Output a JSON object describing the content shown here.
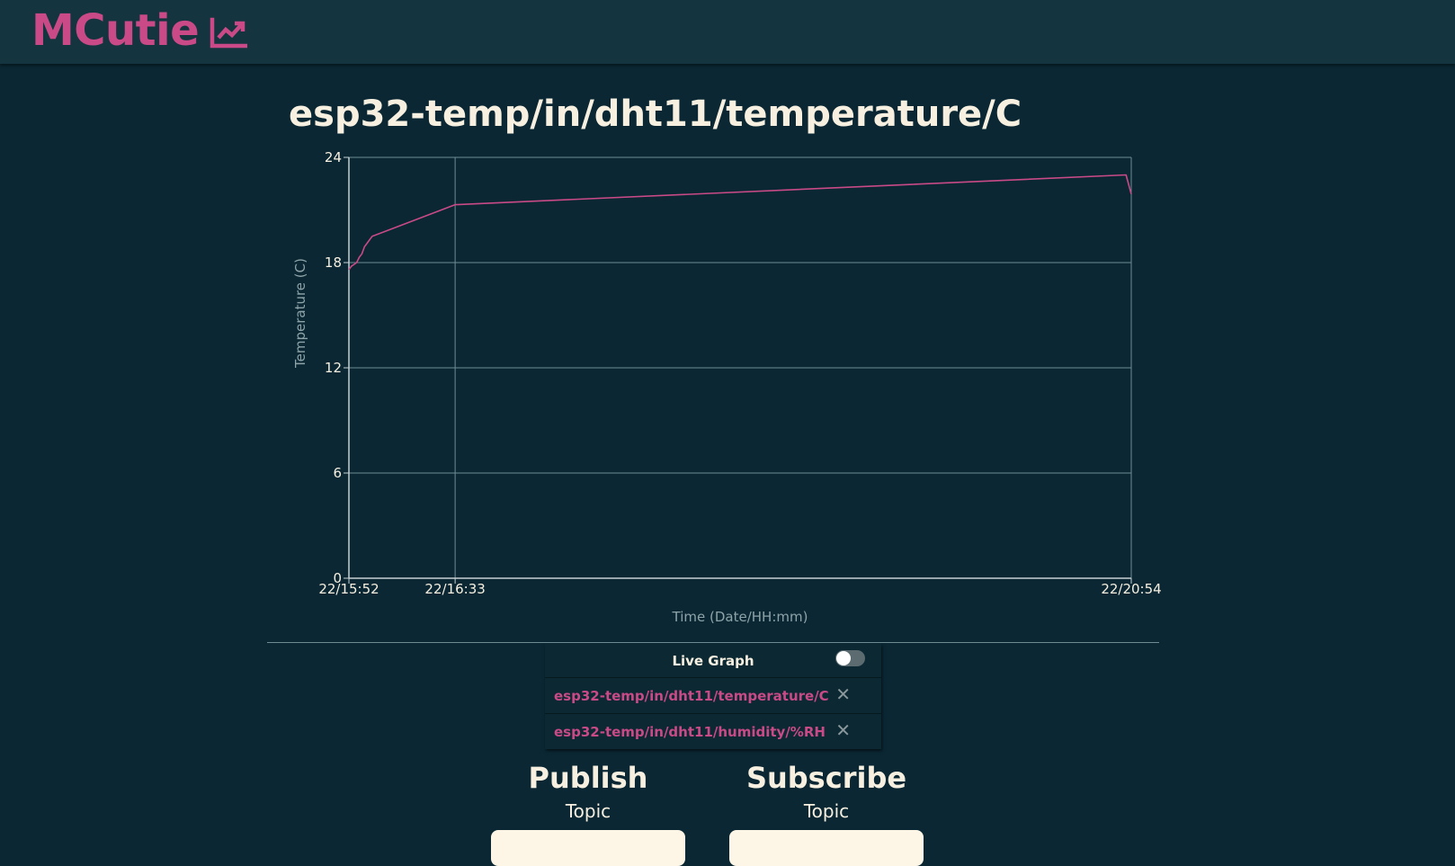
{
  "header": {
    "brand": "MCutie",
    "brand_icon": "line-chart-icon",
    "brand_color": "#c94a86"
  },
  "colors": {
    "background": "#0a2733",
    "header_bg": "#143540",
    "accent": "#c94a86",
    "text": "#f7f0e1",
    "grid": "#6f8c93"
  },
  "chart_data": {
    "type": "line",
    "title": "esp32-temp/in/dht11/temperature/C",
    "xlabel": "Time (Date/HH:mm)",
    "ylabel": "Temperature (C)",
    "ylim": [
      0,
      24
    ],
    "yticks": [
      0,
      6,
      12,
      18,
      24
    ],
    "xlim": [
      "22/15:52",
      "22/20:54"
    ],
    "xticks": [
      "22/15:52",
      "22/16:33",
      "22/20:54"
    ],
    "grid": true,
    "series": [
      {
        "color": "#c94a86",
        "x": [
          "22/15:52",
          "22/15:53",
          "22/15:54",
          "22/15:55",
          "22/15:56",
          "22/15:57",
          "22/15:58",
          "22/15:59",
          "22/16:00",
          "22/16:01",
          "22/16:33",
          "22/20:52",
          "22/20:54"
        ],
        "values": [
          17.6,
          17.8,
          17.9,
          18.0,
          18.3,
          18.5,
          18.9,
          19.1,
          19.3,
          19.5,
          21.3,
          23.0,
          21.9
        ]
      }
    ]
  },
  "topics": {
    "live_graph_label": "Live Graph",
    "live_graph_on": false,
    "items": [
      {
        "name": "esp32-temp/in/dht11/temperature/C",
        "remove_icon": "close-icon"
      },
      {
        "name": "esp32-temp/in/dht11/humidity/%RH",
        "remove_icon": "close-icon"
      }
    ]
  },
  "publish": {
    "title": "Publish",
    "topic_label": "Topic",
    "topic_value": ""
  },
  "subscribe": {
    "title": "Subscribe",
    "topic_label": "Topic",
    "topic_value": ""
  }
}
